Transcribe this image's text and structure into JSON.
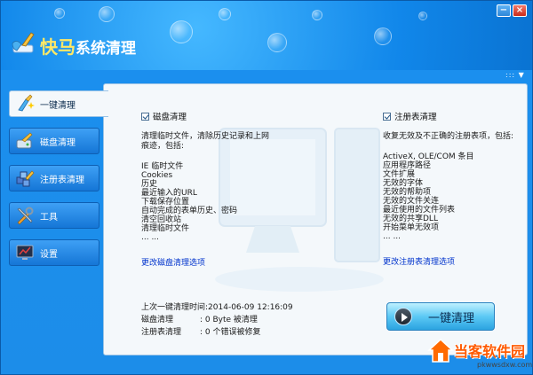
{
  "app": {
    "title_part1": "快马",
    "title_part2": "系统清理"
  },
  "window": {
    "min_glyph": "−",
    "close_glyph": "×",
    "menu_glyph": "::: ▼"
  },
  "sidebar": {
    "items": [
      {
        "label": "一键清理",
        "icon": "broom-sparkle-icon"
      },
      {
        "label": "磁盘清理",
        "icon": "disk-brush-icon"
      },
      {
        "label": "注册表清理",
        "icon": "registry-cubes-icon"
      },
      {
        "label": "工具",
        "icon": "tools-icon"
      },
      {
        "label": "设置",
        "icon": "settings-monitor-icon"
      }
    ]
  },
  "disk": {
    "title": "磁盘清理",
    "desc": "清理临时文件，清除历史记录和上网痕迹，包括:",
    "items": [
      "IE 临时文件",
      "Cookies",
      "历史",
      "最近输入的URL",
      "下载保存位置",
      "自动完成的表单历史、密码",
      "清空回收站",
      "清理临时文件",
      "... ..."
    ],
    "link": "更改磁盘清理选项"
  },
  "registry": {
    "title": "注册表清理",
    "desc": "收复无效及不正确的注册表项，包括:",
    "items": [
      "ActiveX, OLE/COM 条目",
      "应用程序路径",
      "文件扩展",
      "无效的字体",
      "无效的帮助项",
      "无效的文件关连",
      "最近使用的文件列表",
      "无效的共享DLL",
      "开始菜单无效项",
      "... ..."
    ],
    "link": "更改注册表清理选项"
  },
  "stats": {
    "last_label": "上次一键清理时间:",
    "last_value": "2014-06-09 12:16:09",
    "disk_label": "磁盘清理",
    "disk_value": ": 0 Byte 被清理",
    "reg_label": "注册表清理",
    "reg_value": ": 0 个错误被修复"
  },
  "action": {
    "label": "一键清理"
  },
  "brand": {
    "name": "当客软件园",
    "url": "pkwwsdxw.com"
  },
  "colors": {
    "accent": "#1c8de9",
    "title_yellow": "#ffe866",
    "link_blue": "#0033cc",
    "brand_orange": "#ff5a00"
  }
}
